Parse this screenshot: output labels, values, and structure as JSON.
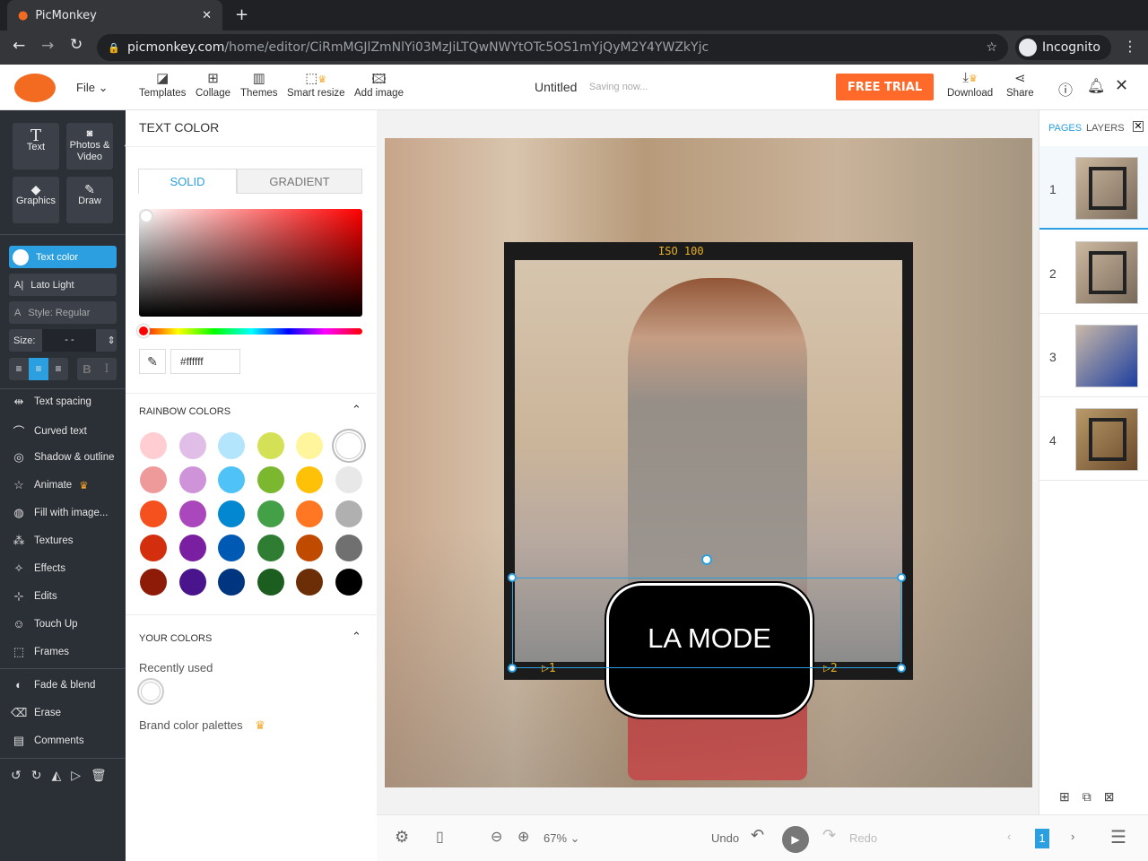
{
  "browser": {
    "tab_title": "PicMonkey",
    "url_host": "picmonkey.com",
    "url_path": "/home/editor/CiRmMGJlZmNlYi03MzJiLTQwNWYtOTc5OS1mYjQyM2Y4YWZkYjc",
    "profile": "Incognito"
  },
  "appbar": {
    "file": "File",
    "tools": [
      "Templates",
      "Collage",
      "Themes",
      "Smart resize",
      "Add image"
    ],
    "doc_title": "Untitled",
    "saving": "Saving now...",
    "free_trial": "FREE TRIAL",
    "download": "Download",
    "share": "Share"
  },
  "leftbar": {
    "big_buttons": [
      "Text",
      "Photos & Video",
      "Graphics",
      "Draw"
    ],
    "text_color": "Text color",
    "font": "Lato Light",
    "style": "Style: Regular",
    "size_label": "Size:",
    "size_value": "- -",
    "bold": "B",
    "italic": "I",
    "menu": [
      "Text spacing",
      "Curved text",
      "Shadow & outline",
      "Animate",
      "Fill with image...",
      "Textures",
      "Effects",
      "Edits",
      "Touch Up",
      "Frames",
      "Fade & blend",
      "Erase",
      "Comments"
    ]
  },
  "panel": {
    "title": "TEXT COLOR",
    "tabs": [
      "SOLID",
      "GRADIENT"
    ],
    "hex": "#ffffff",
    "rainbow_title": "RAINBOW COLORS",
    "your_colors_title": "YOUR COLORS",
    "recently_used": "Recently used",
    "brand_palettes": "Brand color palettes",
    "rainbow": [
      "#ffcdd2",
      "#e1bee7",
      "#b3e5fc",
      "#d4e157",
      "#fff59d",
      "#ffffff",
      "#ef9a9a",
      "#ce93d8",
      "#4fc3f7",
      "#7cb82f",
      "#ffc107",
      "#e8e8e8",
      "#f4511e",
      "#ab47bc",
      "#0288d1",
      "#43a047",
      "#ff7722",
      "#b0b0b0",
      "#d32f0f",
      "#7b1fa2",
      "#0059b3",
      "#2e7d32",
      "#bf4a00",
      "#707070",
      "#8e1a08",
      "#4a148c",
      "#003580",
      "#1b5e20",
      "#6b2e06",
      "#000000"
    ]
  },
  "canvas": {
    "frame_label": "ISO 100",
    "marker_left": "▷1",
    "marker_right": "▷2",
    "text": "LA MODE"
  },
  "rightbar": {
    "tabs": [
      "PAGES",
      "LAYERS"
    ],
    "pages": [
      "1",
      "2",
      "3",
      "4"
    ]
  },
  "bottombar": {
    "zoom": "67%",
    "undo": "Undo",
    "redo": "Redo",
    "page": "1"
  },
  "colors": {
    "accent": "#2b9fe0",
    "brand": "#f26b21",
    "trial": "#ff6a2b"
  }
}
